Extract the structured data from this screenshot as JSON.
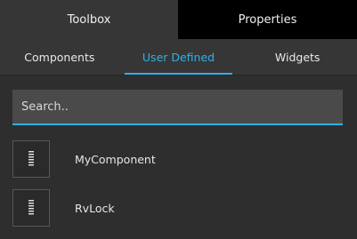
{
  "top_tabs": [
    {
      "label": "Toolbox"
    },
    {
      "label": "Properties"
    }
  ],
  "sub_tabs": [
    {
      "label": "Components"
    },
    {
      "label": "User Defined",
      "active": true
    },
    {
      "label": "Widgets"
    }
  ],
  "search": {
    "placeholder": "Search.."
  },
  "items": [
    {
      "label": "MyComponent",
      "icon": "component-icon"
    },
    {
      "label": "RvLock",
      "icon": "component-icon"
    }
  ],
  "colors": {
    "accent": "#2fb1e6",
    "background": "#2e2e2e",
    "active_top_tab_bg": "#000000"
  }
}
